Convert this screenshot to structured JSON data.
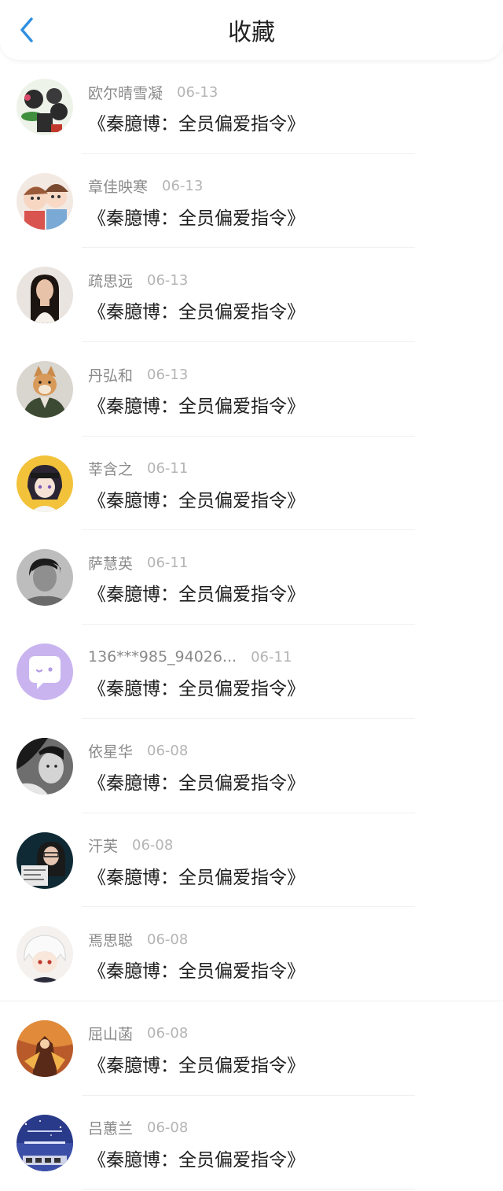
{
  "header": {
    "title": "收藏",
    "back_icon": "chevron-left-icon",
    "accent_color": "#2f8fe0"
  },
  "items": [
    {
      "name": "欧尔晴雪凝",
      "date": "06-13",
      "book": "《秦臆博：全员偏爱指令》"
    },
    {
      "name": "章佳映寒",
      "date": "06-13",
      "book": "《秦臆博：全员偏爱指令》"
    },
    {
      "name": "疏思远",
      "date": "06-13",
      "book": "《秦臆博：全员偏爱指令》"
    },
    {
      "name": "丹弘和",
      "date": "06-13",
      "book": "《秦臆博：全员偏爱指令》"
    },
    {
      "name": "莘含之",
      "date": "06-11",
      "book": "《秦臆博：全员偏爱指令》"
    },
    {
      "name": "萨慧英",
      "date": "06-11",
      "book": "《秦臆博：全员偏爱指令》"
    },
    {
      "name": "136***985_94026...",
      "date": "06-11",
      "book": "《秦臆博：全员偏爱指令》"
    },
    {
      "name": "依星华",
      "date": "06-08",
      "book": "《秦臆博：全员偏爱指令》"
    },
    {
      "name": "汗芙",
      "date": "06-08",
      "book": "《秦臆博：全员偏爱指令》"
    },
    {
      "name": "焉思聪",
      "date": "06-08",
      "book": "《秦臆博：全员偏爱指令》"
    },
    {
      "name": "屈山菡",
      "date": "06-08",
      "book": "《秦臆博：全员偏爱指令》"
    },
    {
      "name": "吕蕙兰",
      "date": "06-08",
      "book": "《秦臆博：全员偏爱指令》"
    }
  ]
}
